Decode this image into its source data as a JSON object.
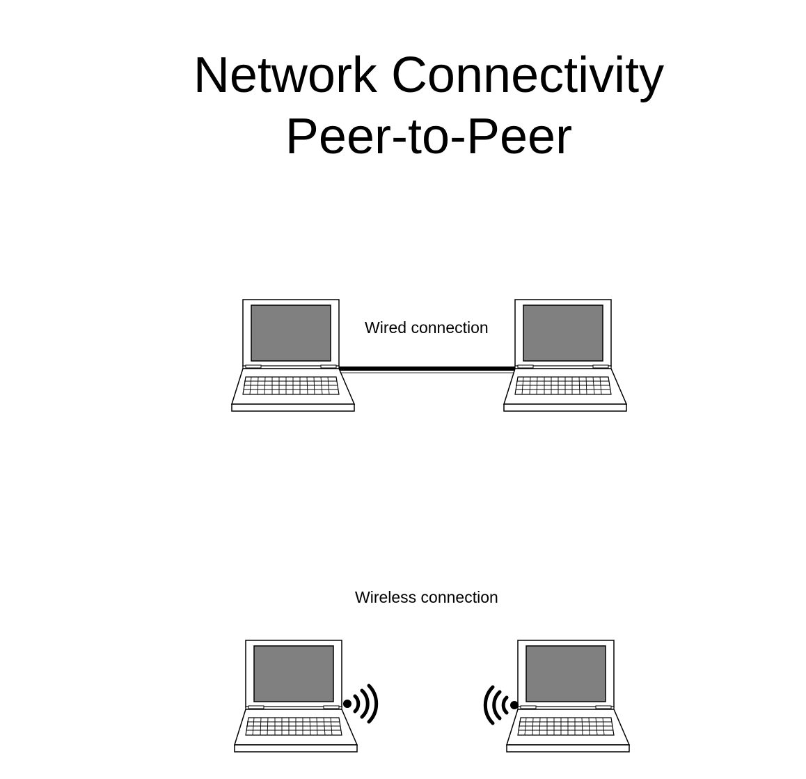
{
  "title": {
    "line1": "Network Connectivity",
    "line2": "Peer-to-Peer"
  },
  "connections": {
    "wired_label": "Wired connection",
    "wireless_label": "Wireless connection"
  },
  "devices": [
    {
      "name": "laptop-wired-left",
      "icon": "laptop-icon"
    },
    {
      "name": "laptop-wired-right",
      "icon": "laptop-icon"
    },
    {
      "name": "laptop-wireless-left",
      "icon": "laptop-icon"
    },
    {
      "name": "laptop-wireless-right",
      "icon": "laptop-icon"
    }
  ],
  "colors": {
    "screen": "#808080",
    "outline": "#000000",
    "background": "#ffffff"
  }
}
